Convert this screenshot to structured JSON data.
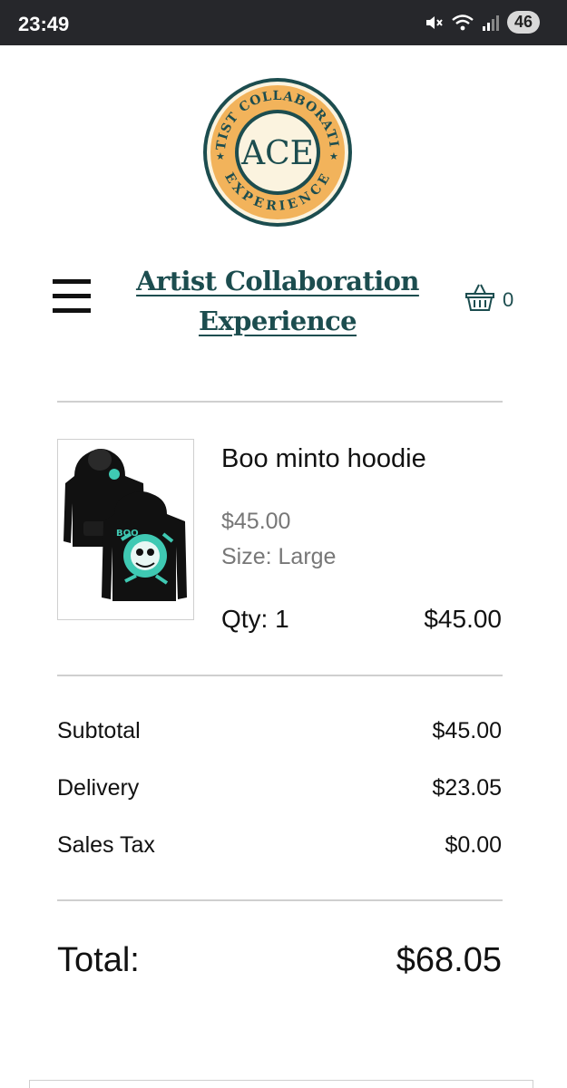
{
  "status_bar": {
    "time": "23:49",
    "battery": "46",
    "icons": [
      "mute-icon",
      "wifi-icon",
      "signal-icon"
    ]
  },
  "logo": {
    "ring_text_top": "ARTIST COLLABORATION",
    "ring_text_bottom": "EXPERIENCE",
    "center_text": "ACE",
    "colors": {
      "ring": "#f2b35b",
      "dark": "#1c4d4f",
      "center": "#fbf3df"
    }
  },
  "header": {
    "title_line1": "Artist Collaboration",
    "title_line2": "Experience",
    "cart_count": "0",
    "accent_color": "#1c4d4f"
  },
  "cart_item": {
    "name": "Boo minto hoodie",
    "price": "$45.00",
    "size": "Size: Large",
    "qty": "Qty: 1",
    "line_total": "$45.00"
  },
  "summary": {
    "subtotal_label": "Subtotal",
    "subtotal_value": "$45.00",
    "delivery_label": "Delivery",
    "delivery_value": "$23.05",
    "tax_label": "Sales Tax",
    "tax_value": "$0.00"
  },
  "total": {
    "label": "Total:",
    "value": "$68.05"
  }
}
